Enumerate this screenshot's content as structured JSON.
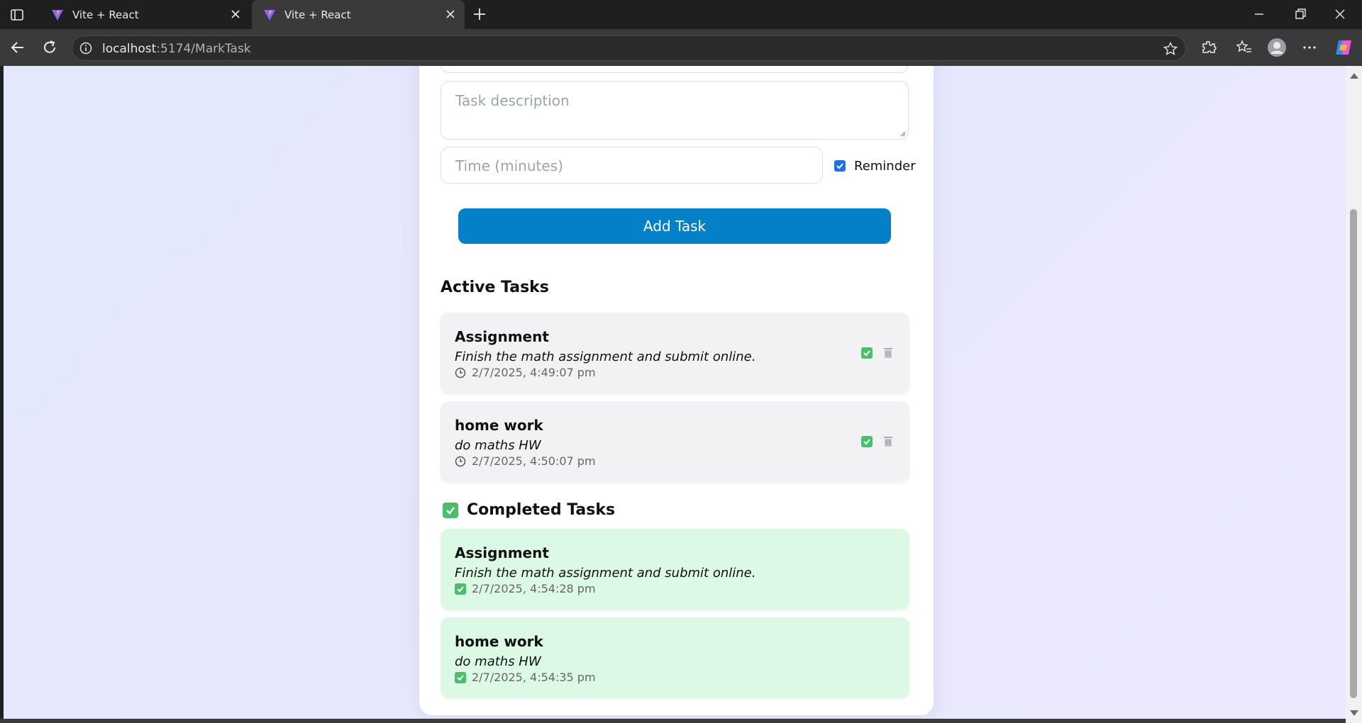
{
  "browser": {
    "tabs": [
      {
        "title": "Vite + React"
      },
      {
        "title": "Vite + React"
      }
    ],
    "url": {
      "host": "localhost",
      "path": ":5174/MarkTask"
    }
  },
  "form": {
    "description_placeholder": "Task description",
    "time_placeholder": "Time (minutes)",
    "reminder_label": "Reminder",
    "reminder_checked": true,
    "add_button": "Add Task"
  },
  "active": {
    "heading": "Active Tasks",
    "tasks": [
      {
        "title": "Assignment",
        "description": "Finish the math assignment and submit online.",
        "time": "2/7/2025, 4:49:07 pm"
      },
      {
        "title": "home work",
        "description": "do maths HW",
        "time": "2/7/2025, 4:50:07 pm"
      }
    ]
  },
  "completed": {
    "heading": "Completed Tasks",
    "tasks": [
      {
        "title": "Assignment",
        "description": "Finish the math assignment and submit online.",
        "time": "2/7/2025, 4:54:28 pm"
      },
      {
        "title": "home work",
        "description": "do maths HW",
        "time": "2/7/2025, 4:54:35 pm"
      }
    ]
  },
  "colors": {
    "accent": "#0380c8",
    "done_bg": "#dcf9e6",
    "active_bg": "#f2f2f4",
    "check_green": "#4bbe6a"
  }
}
